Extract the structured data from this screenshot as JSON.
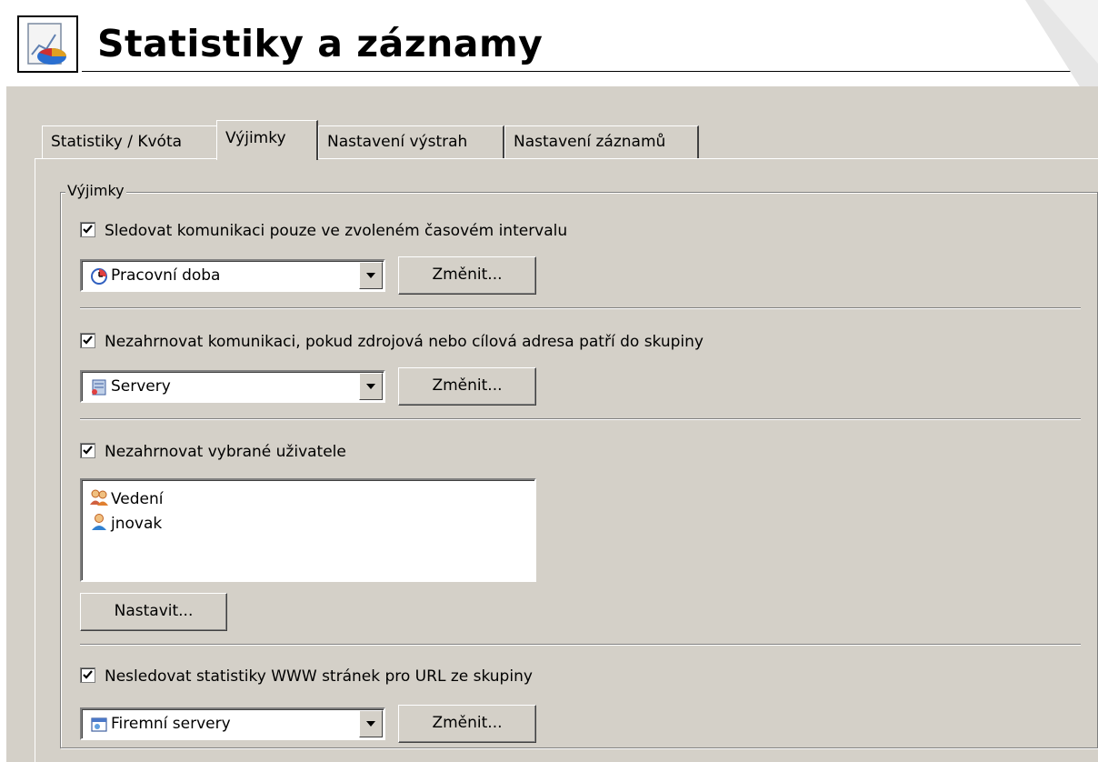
{
  "header": {
    "title": "Statistiky a záznamy",
    "icon": "statistics-chart-icon"
  },
  "tabs": [
    {
      "label": "Statistiky / Kvóta",
      "active": false
    },
    {
      "label": "Výjimky",
      "active": true
    },
    {
      "label": "Nastavení výstrah",
      "active": false
    },
    {
      "label": "Nastavení záznamů",
      "active": false
    }
  ],
  "exceptions": {
    "legend": "Výjimky",
    "time_interval": {
      "checkbox_label": "Sledovat komunikaci pouze ve zvoleném časovém intervalu",
      "checked": true,
      "selected": "Pracovní doba",
      "icon": "clock-icon",
      "change_label": "Změnit..."
    },
    "address_group": {
      "checkbox_label": "Nezahrnovat komunikaci, pokud zdrojová nebo cílová adresa patří do skupiny",
      "checked": true,
      "selected": "Servery",
      "icon": "server-group-icon",
      "change_label": "Změnit..."
    },
    "users": {
      "checkbox_label": "Nezahrnovat vybrané uživatele",
      "checked": true,
      "items": [
        {
          "label": "Vedení",
          "icon": "user-group-icon"
        },
        {
          "label": "jnovak",
          "icon": "user-icon"
        }
      ],
      "set_label": "Nastavit..."
    },
    "url_group": {
      "checkbox_label": "Nesledovat statistiky WWW stránek pro URL ze skupiny",
      "checked": true,
      "selected": "Firemní servery",
      "icon": "url-group-icon",
      "change_label": "Změnit..."
    }
  },
  "colors": {
    "panel": "#d4d0c8",
    "window": "#ffffff"
  }
}
